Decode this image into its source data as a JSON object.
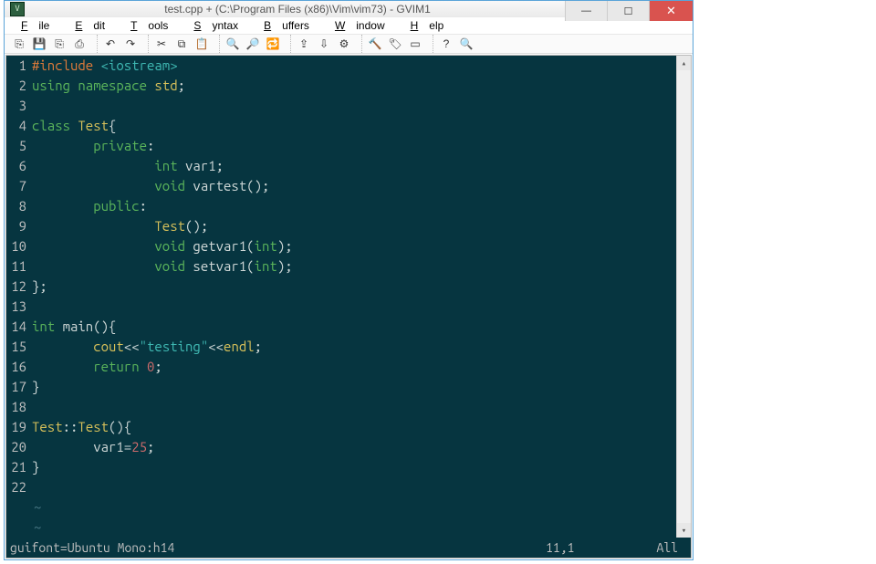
{
  "window": {
    "title": "test.cpp + (C:\\Program Files (x86)\\Vim\\vim73) - GVIM1",
    "app_icon_text": "V"
  },
  "win_controls": {
    "min": "—",
    "max": "☐",
    "close": "✕"
  },
  "menu": {
    "file": {
      "u": "F",
      "rest": "ile"
    },
    "edit": {
      "u": "E",
      "rest": "dit"
    },
    "tools": {
      "u": "T",
      "rest": "ools"
    },
    "syntax": {
      "u": "S",
      "rest": "yntax"
    },
    "buffers": {
      "u": "B",
      "rest": "uffers"
    },
    "window": {
      "u": "W",
      "rest": "indow"
    },
    "help": {
      "u": "H",
      "rest": "elp"
    }
  },
  "toolbar": {
    "open": "⎘",
    "save": "💾",
    "saveall": "⎘",
    "print": "⎙",
    "undo": "↶",
    "redo": "↷",
    "cut": "✂",
    "copy": "⧉",
    "paste": "📋",
    "find": "🔍",
    "findb": "🔎",
    "replace": "🔁",
    "load": "⇪",
    "sess": "⇩",
    "script": "⚙",
    "make": "🔨",
    "tag": "🏷",
    "shell": "▭",
    "help": "?",
    "findh": "🔍"
  },
  "code": {
    "lines": [
      {
        "n": "1",
        "segs": [
          [
            "pre",
            "#include "
          ],
          [
            "str",
            "<iostream>"
          ]
        ]
      },
      {
        "n": "2",
        "segs": [
          [
            "key",
            "using "
          ],
          [
            "key",
            "namespace "
          ],
          [
            "type",
            "std"
          ],
          [
            "punc",
            ";"
          ]
        ]
      },
      {
        "n": "3",
        "segs": [
          [
            "punc",
            ""
          ]
        ]
      },
      {
        "n": "4",
        "segs": [
          [
            "key",
            "class "
          ],
          [
            "type",
            "Test"
          ],
          [
            "punc",
            "{"
          ]
        ]
      },
      {
        "n": "5",
        "segs": [
          [
            "punc",
            "        "
          ],
          [
            "key",
            "private"
          ],
          [
            "punc",
            ":"
          ]
        ]
      },
      {
        "n": "6",
        "segs": [
          [
            "punc",
            "                "
          ],
          [
            "key",
            "int "
          ],
          [
            "punc",
            "var1;"
          ]
        ]
      },
      {
        "n": "7",
        "segs": [
          [
            "punc",
            "                "
          ],
          [
            "key",
            "void "
          ],
          [
            "punc",
            "vartest();"
          ]
        ]
      },
      {
        "n": "8",
        "segs": [
          [
            "punc",
            "        "
          ],
          [
            "key",
            "public"
          ],
          [
            "punc",
            ":"
          ]
        ]
      },
      {
        "n": "9",
        "segs": [
          [
            "punc",
            "                "
          ],
          [
            "type",
            "Test"
          ],
          [
            "punc",
            "();"
          ]
        ]
      },
      {
        "n": "10",
        "segs": [
          [
            "punc",
            "                "
          ],
          [
            "key",
            "void "
          ],
          [
            "punc",
            "getvar1("
          ],
          [
            "key",
            "int"
          ],
          [
            "punc",
            ");"
          ]
        ]
      },
      {
        "n": "11",
        "segs": [
          [
            "punc",
            "                "
          ],
          [
            "key",
            "void "
          ],
          [
            "punc",
            "setvar1("
          ],
          [
            "key",
            "int"
          ],
          [
            "punc",
            ");"
          ]
        ]
      },
      {
        "n": "12",
        "segs": [
          [
            "punc",
            "};"
          ]
        ]
      },
      {
        "n": "13",
        "segs": [
          [
            "punc",
            ""
          ]
        ]
      },
      {
        "n": "14",
        "segs": [
          [
            "key",
            "int "
          ],
          [
            "punc",
            "main(){"
          ]
        ]
      },
      {
        "n": "15",
        "segs": [
          [
            "punc",
            "        "
          ],
          [
            "type",
            "cout"
          ],
          [
            "punc",
            "<<"
          ],
          [
            "str2",
            "\"testing\""
          ],
          [
            "punc",
            "<<"
          ],
          [
            "type",
            "endl"
          ],
          [
            "punc",
            ";"
          ]
        ]
      },
      {
        "n": "16",
        "segs": [
          [
            "punc",
            "        "
          ],
          [
            "key",
            "return "
          ],
          [
            "num",
            "0"
          ],
          [
            "punc",
            ";"
          ]
        ]
      },
      {
        "n": "17",
        "segs": [
          [
            "punc",
            "}"
          ]
        ]
      },
      {
        "n": "18",
        "segs": [
          [
            "punc",
            ""
          ]
        ]
      },
      {
        "n": "19",
        "segs": [
          [
            "type",
            "Test"
          ],
          [
            "punc",
            "::"
          ],
          [
            "type",
            "Test"
          ],
          [
            "punc",
            "(){"
          ]
        ]
      },
      {
        "n": "20",
        "segs": [
          [
            "punc",
            "        var1="
          ],
          [
            "num",
            "25"
          ],
          [
            "punc",
            ";"
          ]
        ]
      },
      {
        "n": "21",
        "segs": [
          [
            "punc",
            "}"
          ]
        ]
      },
      {
        "n": "22",
        "segs": [
          [
            "punc",
            ""
          ]
        ]
      }
    ],
    "tildes": 2
  },
  "status": {
    "cmd": " guifont=Ubuntu Mono:h14",
    "pos": "11,1",
    "pct": "All"
  }
}
